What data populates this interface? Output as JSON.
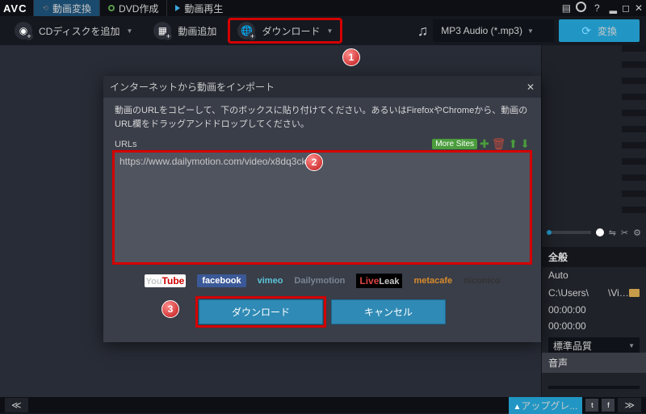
{
  "app": {
    "logo": "AVC"
  },
  "tabs": {
    "convert": "動画変換",
    "dvd": "DVD作成",
    "play": "動画再生"
  },
  "toolbar": {
    "add_disc": "CDディスクを追加",
    "add_video": "動画追加",
    "download": "ダウンロード",
    "format": "MP3 Audio (*.mp3)",
    "convert": "変換"
  },
  "dialog": {
    "title": "インターネットから動画をインポート",
    "instruction": "動画のURLをコピーして、下のボックスに貼り付けてください。あるいはFirefoxやChromeから、動画のURL欄をドラッグアンドドロップしてください。",
    "urls_label": "URLs",
    "more_sites": "More Sites",
    "url_value": "https://www.dailymotion.com/video/x8dq3ck",
    "download_btn": "ダウンロード",
    "cancel_btn": "キャンセル",
    "sites": {
      "youtube_a": "You",
      "youtube_b": "Tube",
      "facebook": "facebook",
      "vimeo": "vimeo",
      "dailymotion": "Dailymotion",
      "liveleak_a": "Live",
      "liveleak_b": "Leak",
      "metacafe": "metacafe",
      "niconico": "niconico"
    }
  },
  "side": {
    "general": "全般",
    "auto": "Auto",
    "path": "C:\\Users\\　　\\Videos\\A...",
    "time1": "00:00:00",
    "time2": "00:00:00",
    "quality": "標準品質",
    "audio": "音声"
  },
  "footer": {
    "upgrade": "アップグレ..."
  }
}
